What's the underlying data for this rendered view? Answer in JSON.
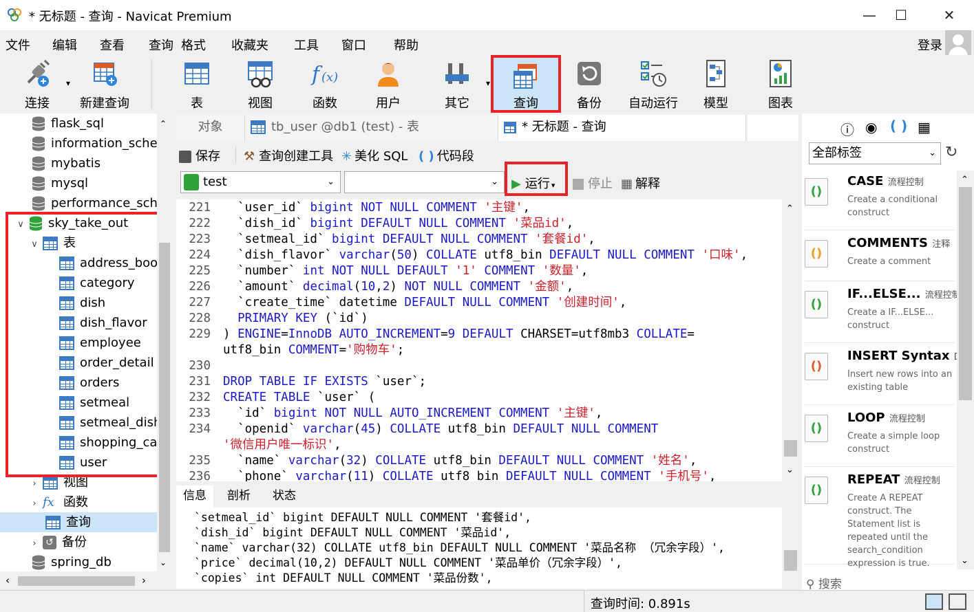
{
  "window": {
    "title": "* 无标题 - 查询 - Navicat Premium"
  },
  "menu": [
    "文件",
    "编辑",
    "查看",
    "查询",
    "格式",
    "收藏夹",
    "工具",
    "窗口",
    "帮助"
  ],
  "account": {
    "login": "登录"
  },
  "toolbar": {
    "connect": "连接",
    "new_query": "新建查询",
    "table": "表",
    "view": "视图",
    "function": "函数",
    "user": "用户",
    "other": "其它",
    "query": "查询",
    "backup": "备份",
    "autorun": "自动运行",
    "model": "模型",
    "chart": "图表"
  },
  "tree": {
    "databases_top": [
      "flask_sql",
      "information_schem",
      "mybatis",
      "mysql",
      "performance_sche"
    ],
    "open_db": "sky_take_out",
    "tables_folder": "表",
    "tables": [
      "address_boo",
      "category",
      "dish",
      "dish_flavor",
      "employee",
      "order_detail",
      "orders",
      "setmeal",
      "setmeal_dish",
      "shopping_ca",
      "user"
    ],
    "views_folder": "视图",
    "functions_folder": "函数",
    "queries_folder": "查询",
    "backups_folder": "备份",
    "last_db": "spring_db"
  },
  "tabs": {
    "objects": "对象",
    "tb_user": "tb_user @db1 (test) - 表",
    "untitled": "* 无标题 - 查询"
  },
  "query_toolbar": {
    "save": "保存",
    "builder": "查询创建工具",
    "beautify": "美化 SQL",
    "snippet": "代码段"
  },
  "selectors": {
    "connection": "test",
    "database": "",
    "run": "运行",
    "stop": "停止",
    "explain": "解释"
  },
  "code_lines": [
    {
      "n": "221",
      "t": "  `user_id` bigint NOT NULL COMMENT '主键',"
    },
    {
      "n": "222",
      "t": "  `dish_id` bigint DEFAULT NULL COMMENT '菜品id',"
    },
    {
      "n": "223",
      "t": "  `setmeal_id` bigint DEFAULT NULL COMMENT '套餐id',"
    },
    {
      "n": "224",
      "t": "  `dish_flavor` varchar(50) COLLATE utf8_bin DEFAULT NULL COMMENT '口味',"
    },
    {
      "n": "225",
      "t": "  `number` int NOT NULL DEFAULT '1' COMMENT '数量',"
    },
    {
      "n": "226",
      "t": "  `amount` decimal(10,2) NOT NULL COMMENT '金额',"
    },
    {
      "n": "227",
      "t": "  `create_time` datetime DEFAULT NULL COMMENT '创建时间',"
    },
    {
      "n": "228",
      "t": "  PRIMARY KEY (`id`)"
    },
    {
      "n": "229",
      "t": ") ENGINE=InnoDB AUTO_INCREMENT=9 DEFAULT CHARSET=utf8mb3 COLLATE="
    },
    {
      "n": "",
      "t": "utf8_bin COMMENT='购物车';"
    },
    {
      "n": "230",
      "t": ""
    },
    {
      "n": "231",
      "t": "DROP TABLE IF EXISTS `user`;"
    },
    {
      "n": "232",
      "t": "CREATE TABLE `user` ("
    },
    {
      "n": "233",
      "t": "  `id` bigint NOT NULL AUTO_INCREMENT COMMENT '主键',"
    },
    {
      "n": "234",
      "t": "  `openid` varchar(45) COLLATE utf8_bin DEFAULT NULL COMMENT"
    },
    {
      "n": "",
      "t": "'微信用户唯一标识',"
    },
    {
      "n": "235",
      "t": "  `name` varchar(32) COLLATE utf8_bin DEFAULT NULL COMMENT '姓名',"
    },
    {
      "n": "236",
      "t": "  `phone` varchar(11) COLLATE utf8_bin DEFAULT NULL COMMENT '手机号',"
    }
  ],
  "bottom_tabs": [
    "信息",
    "剖析",
    "状态"
  ],
  "output_lines": [
    "`setmeal_id` bigint DEFAULT NULL COMMENT '套餐id',",
    "`dish_id` bigint DEFAULT NULL COMMENT '菜品id',",
    "`name` varchar(32) COLLATE utf8_bin DEFAULT NULL COMMENT '菜品名称 （冗余字段）',",
    "`price` decimal(10,2) DEFAULT NULL COMMENT '菜品单价（冗余字段）',",
    "`copies` int DEFAULT NULL COMMENT '菜品份数',"
  ],
  "snippets": {
    "filter": "全部标签",
    "search_placeholder": "搜索",
    "items": [
      {
        "title": "CASE",
        "tag": "流程控制",
        "desc": "Create a conditional construct"
      },
      {
        "title": "COMMENTS",
        "tag": "注释",
        "desc": "Create a comment"
      },
      {
        "title": "IF...ELSE...",
        "tag": "流程控制",
        "desc": "Create a IF...ELSE... construct"
      },
      {
        "title": "INSERT Syntax",
        "tag": "DM",
        "desc": "Insert new rows into an existing table"
      },
      {
        "title": "LOOP",
        "tag": "流程控制",
        "desc": "Create a simple loop construct"
      },
      {
        "title": "REPEAT",
        "tag": "流程控制",
        "desc": "Create A REPEAT construct. The Statement list is repeated until the search_condition expression is true."
      }
    ]
  },
  "status": {
    "query_time": "查询时间: 0.891s"
  },
  "colors": {
    "highlight_red": "#e8232a",
    "keyword_blue": "#1a1acc",
    "string_red": "#d0202a",
    "selected_bg": "#cce4f7"
  }
}
